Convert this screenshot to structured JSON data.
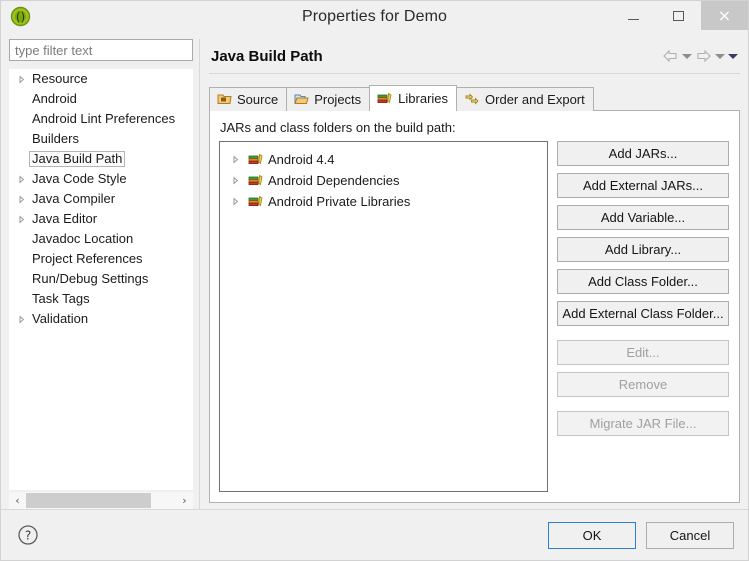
{
  "window": {
    "title": "Properties for Demo",
    "app_icon": "eclipse-icon",
    "controls": {
      "minimize": "minimize-button",
      "maximize": "maximize-button",
      "close": "×"
    }
  },
  "sidebar": {
    "filter": {
      "value": "",
      "placeholder": "type filter text"
    },
    "items": [
      {
        "label": "Resource",
        "expandable": true,
        "selected": false
      },
      {
        "label": "Android",
        "expandable": false,
        "selected": false
      },
      {
        "label": "Android Lint Preferences",
        "expandable": false,
        "selected": false
      },
      {
        "label": "Builders",
        "expandable": false,
        "selected": false
      },
      {
        "label": "Java Build Path",
        "expandable": false,
        "selected": true
      },
      {
        "label": "Java Code Style",
        "expandable": true,
        "selected": false
      },
      {
        "label": "Java Compiler",
        "expandable": true,
        "selected": false
      },
      {
        "label": "Java Editor",
        "expandable": true,
        "selected": false
      },
      {
        "label": "Javadoc Location",
        "expandable": false,
        "selected": false
      },
      {
        "label": "Project References",
        "expandable": false,
        "selected": false
      },
      {
        "label": "Run/Debug Settings",
        "expandable": false,
        "selected": false
      },
      {
        "label": "Task Tags",
        "expandable": false,
        "selected": false
      },
      {
        "label": "Validation",
        "expandable": true,
        "selected": false
      }
    ],
    "scrollbar": {
      "left_arrow": "‹",
      "right_arrow": "›"
    }
  },
  "page": {
    "title": "Java Build Path",
    "nav": {
      "back": "back-arrow",
      "back_menu": "back-dropdown",
      "forward": "forward-arrow",
      "forward_menu": "forward-dropdown",
      "menu": "view-menu"
    },
    "tabs": [
      {
        "label": "Source",
        "icon": "source-folder-icon",
        "active": false
      },
      {
        "label": "Projects",
        "icon": "projects-folder-icon",
        "active": false
      },
      {
        "label": "Libraries",
        "icon": "libraries-books-icon",
        "active": true
      },
      {
        "label": "Order and Export",
        "icon": "order-export-arrows-icon",
        "active": false
      }
    ],
    "tab_body_label": "JARs and class folders on the build path:",
    "entries": [
      {
        "label": "Android 4.4",
        "icon": "library-books-icon",
        "expandable": true
      },
      {
        "label": "Android Dependencies",
        "icon": "library-books-icon",
        "expandable": true
      },
      {
        "label": "Android Private Libraries",
        "icon": "library-books-icon",
        "expandable": true
      }
    ],
    "buttons": [
      {
        "label": "Add JARs...",
        "enabled": true
      },
      {
        "label": "Add External JARs...",
        "enabled": true
      },
      {
        "label": "Add Variable...",
        "enabled": true
      },
      {
        "label": "Add Library...",
        "enabled": true
      },
      {
        "label": "Add Class Folder...",
        "enabled": true
      },
      {
        "label": "Add External Class Folder...",
        "enabled": true
      },
      {
        "label": "Edit...",
        "enabled": false
      },
      {
        "label": "Remove",
        "enabled": false
      },
      {
        "label": "Migrate JAR File...",
        "enabled": false
      }
    ]
  },
  "footer": {
    "help": "help-icon",
    "ok": "OK",
    "cancel": "Cancel"
  },
  "colors": {
    "accent": "#2a7fd4",
    "window_bg": "#f0f0f0",
    "panel_bg": "#ffffff",
    "close_bg": "#c8c8c8"
  }
}
